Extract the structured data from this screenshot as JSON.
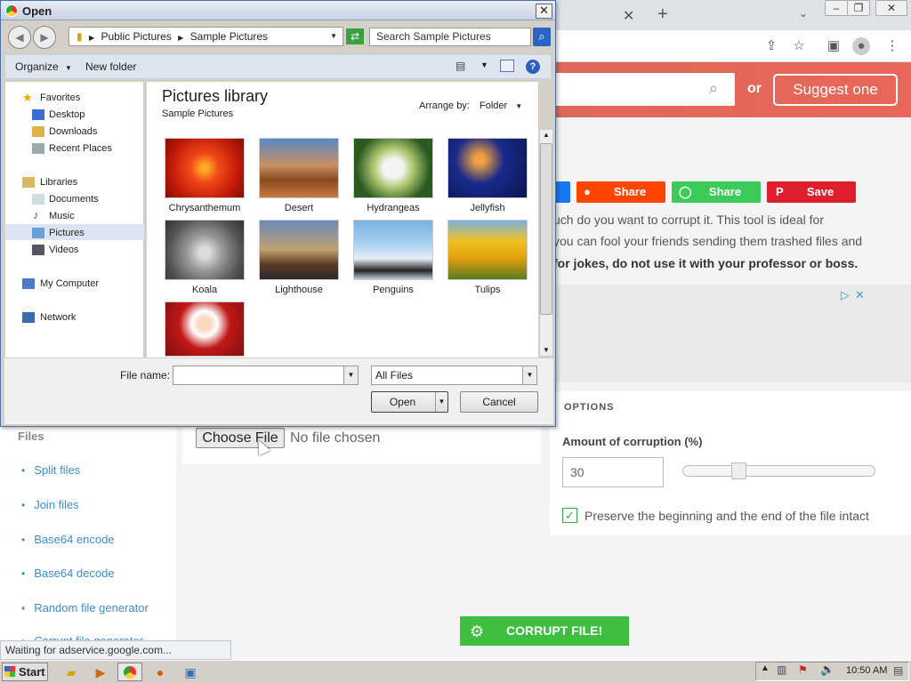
{
  "browser": {
    "statusbar": "Waiting for adservice.google.com...",
    "hero": {
      "or_text": "or",
      "suggest_button": "Suggest one"
    },
    "share_buttons": [
      {
        "label": "Share",
        "icon": "reddit-icon",
        "color": "#ff4500"
      },
      {
        "label": "Share",
        "icon": "whatsapp-icon",
        "color": "#3ccb5b"
      },
      {
        "label": "Save",
        "icon": "pinterest-icon",
        "color": "#e01f2d"
      }
    ],
    "body_lines": [
      "uch do you want to corrupt it. This tool is ideal for",
      "you can fool your friends sending them trashed files and",
      " for jokes, do not use it with your professor or boss."
    ],
    "options": {
      "title": "OPTIONS",
      "corruption_label": "Amount of corruption (%)",
      "corruption_value": "30",
      "slider_level": 0.3,
      "preserve_label": "Preserve the beginning and the end of the file intact",
      "preserve_checked": true
    },
    "file_input": {
      "button": "Choose File",
      "status": "No file chosen"
    },
    "sidebar": {
      "heading": "Files",
      "items": [
        "Split files",
        "Join files",
        "Base64 encode",
        "Base64 decode",
        "Random file generator",
        "Corrupt file generator"
      ]
    },
    "corrupt_button": "CORRUPT FILE!",
    "accent_green": "#3fbf3f"
  },
  "dialog": {
    "title": "Open",
    "address": {
      "parts": [
        "Public Pictures",
        "Sample Pictures"
      ]
    },
    "search_placeholder": "Search Sample Pictures",
    "commands": {
      "organize": "Organize",
      "new_folder": "New folder"
    },
    "nav": {
      "favorites": "Favorites",
      "favorites_items": [
        "Desktop",
        "Downloads",
        "Recent Places"
      ],
      "libraries": "Libraries",
      "libraries_items": [
        "Documents",
        "Music",
        "Pictures",
        "Videos"
      ],
      "selected": "Pictures",
      "computer": "My Computer",
      "network": "Network"
    },
    "library": {
      "title": "Pictures library",
      "subtitle": "Sample Pictures",
      "arrange_label": "Arrange by:",
      "arrange_value": "Folder"
    },
    "files": [
      {
        "name": "Chrysanthemum"
      },
      {
        "name": "Desert"
      },
      {
        "name": "Hydrangeas"
      },
      {
        "name": "Jellyfish"
      },
      {
        "name": "Koala"
      },
      {
        "name": "Lighthouse"
      },
      {
        "name": "Penguins"
      },
      {
        "name": "Tulips"
      },
      {
        "name": ""
      }
    ],
    "file_name_label": "File name:",
    "file_name_value": "",
    "file_type": "All Files",
    "open_button": "Open",
    "cancel_button": "Cancel"
  },
  "taskbar": {
    "start": "Start",
    "clock": "10:50 AM"
  }
}
